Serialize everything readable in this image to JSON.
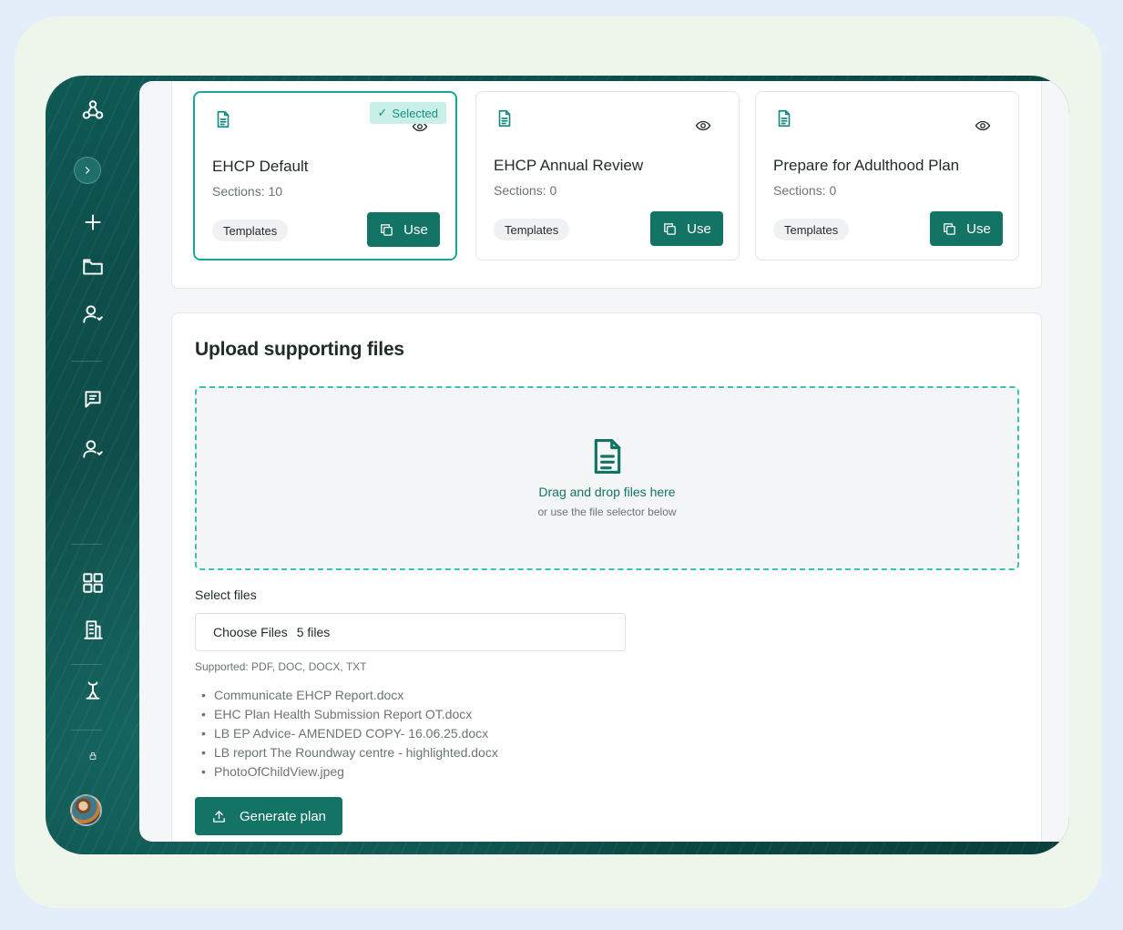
{
  "templates": [
    {
      "title": "EHCP Default",
      "sections": "Sections: 10",
      "tag": "Templates",
      "use_label": "Use",
      "selected": true,
      "badge": "Selected"
    },
    {
      "title": "EHCP Annual Review",
      "sections": "Sections: 0",
      "tag": "Templates",
      "use_label": "Use",
      "selected": false
    },
    {
      "title": "Prepare for Adulthood Plan",
      "sections": "Sections: 0",
      "tag": "Templates",
      "use_label": "Use",
      "selected": false
    }
  ],
  "upload": {
    "title": "Upload supporting files",
    "drop_main": "Drag and drop files here",
    "drop_sub": "or use the file selector below",
    "select_label": "Select files",
    "choose_label": "Choose Files",
    "chosen_text": "5 files",
    "supported": "Supported: PDF, DOC, DOCX, TXT",
    "files": [
      "Communicate EHCP Report.docx",
      "EHC Plan Health Submission Report OT.docx",
      "LB EP Advice- AMENDED COPY- 16.06.25.docx",
      "LB report The Roundway centre - highlighted.docx",
      "PhotoOfChildView.jpeg"
    ],
    "generate_label": "Generate plan"
  },
  "sidebar": {
    "icons": [
      "logo-icon",
      "expand-icon",
      "plus-icon",
      "folder-icon",
      "user-check-icon",
      "message-icon",
      "user-check-icon",
      "grid-icon",
      "building-icon",
      "person-icon",
      "small-icon"
    ]
  },
  "colors": {
    "accent": "#137466",
    "accent_light": "#3cc1b3",
    "sidebar": "#0b4441"
  }
}
